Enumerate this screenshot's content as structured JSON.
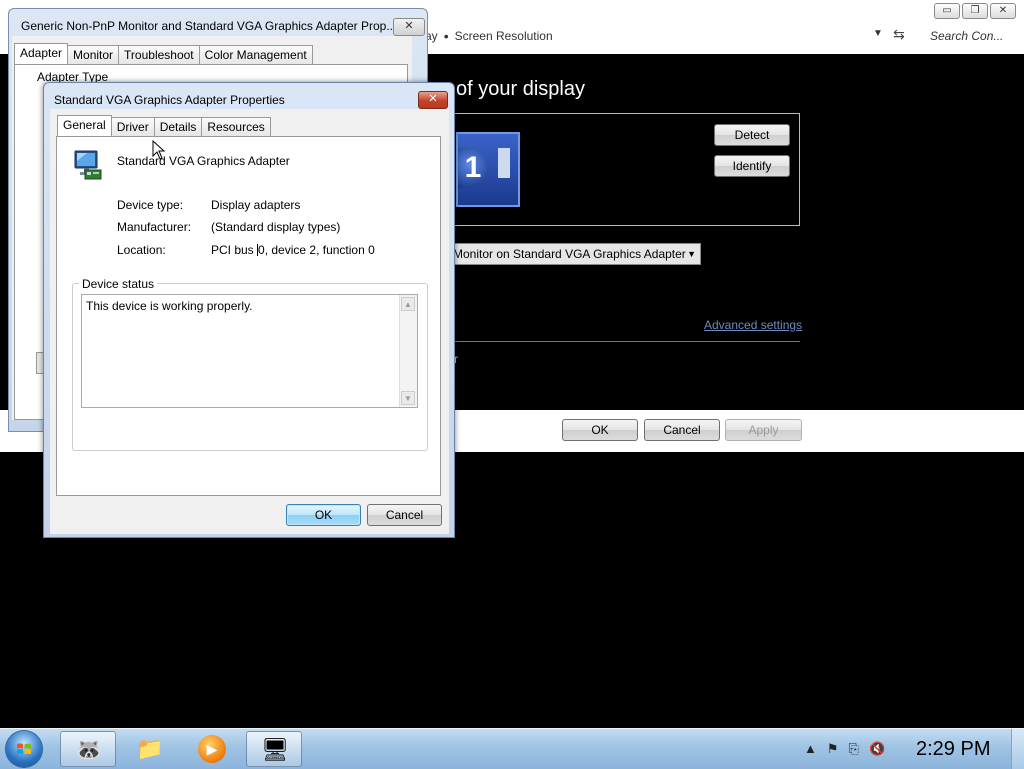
{
  "screen_resolution_window": {
    "breadcrumb_tail": "Screen Resolution",
    "breadcrumb_partial": "ay",
    "search_placeholder": "Search Con...",
    "heading": "of your display",
    "monitor_number": "1",
    "detect_label": "Detect",
    "identify_label": "Identify",
    "display_select_value": "Monitor on Standard VGA Graphics Adapter",
    "advanced_settings_link": "Advanced settings",
    "partial_text": "r",
    "ok_label": "OK",
    "cancel_label": "Cancel",
    "apply_label": "Apply",
    "window_controls": {
      "minimize": "▭",
      "restore": "❐",
      "close": "✕"
    }
  },
  "monitor_properties_dialog": {
    "title": "Generic Non-PnP Monitor and Standard VGA Graphics Adapter Prop...",
    "close_label": "✕",
    "tabs": [
      {
        "label": "Adapter",
        "active": true
      },
      {
        "label": "Monitor",
        "active": false
      },
      {
        "label": "Troubleshoot",
        "active": false
      },
      {
        "label": "Color Management",
        "active": false
      }
    ],
    "adapter_type_label": "Adapter Type"
  },
  "vga_properties_dialog": {
    "title": "Standard VGA Graphics Adapter Properties",
    "close_label": "✕",
    "tabs": [
      {
        "label": "General",
        "active": true
      },
      {
        "label": "Driver",
        "active": false
      },
      {
        "label": "Details",
        "active": false
      },
      {
        "label": "Resources",
        "active": false
      }
    ],
    "device_name": "Standard VGA Graphics Adapter",
    "device_type_label": "Device type:",
    "device_type_value": "Display adapters",
    "manufacturer_label": "Manufacturer:",
    "manufacturer_value": "(Standard display types)",
    "location_label": "Location:",
    "location_value_before_caret": "PCI bus ",
    "location_value_after_caret": "0, device 2, function 0",
    "device_status_label": "Device status",
    "device_status_text": "This device is working properly.",
    "ok_label": "OK",
    "cancel_label": "Cancel"
  },
  "taskbar": {
    "clock": "2:29 PM",
    "items": [
      {
        "name": "raccoon-app-icon",
        "glyph": "🦝",
        "active": true
      },
      {
        "name": "explorer-icon",
        "glyph": "📁",
        "active": false
      },
      {
        "name": "media-player-icon",
        "glyph": "▶",
        "active": false
      },
      {
        "name": "display-settings-icon",
        "glyph": "🖥",
        "active": true
      }
    ],
    "tray_icons": [
      "▲",
      "⚑",
      "⎘",
      "🔇"
    ]
  },
  "colors": {
    "accent_blue": "#3c7fb1",
    "close_red": "#c4432a",
    "link": "#6c8cbf"
  }
}
